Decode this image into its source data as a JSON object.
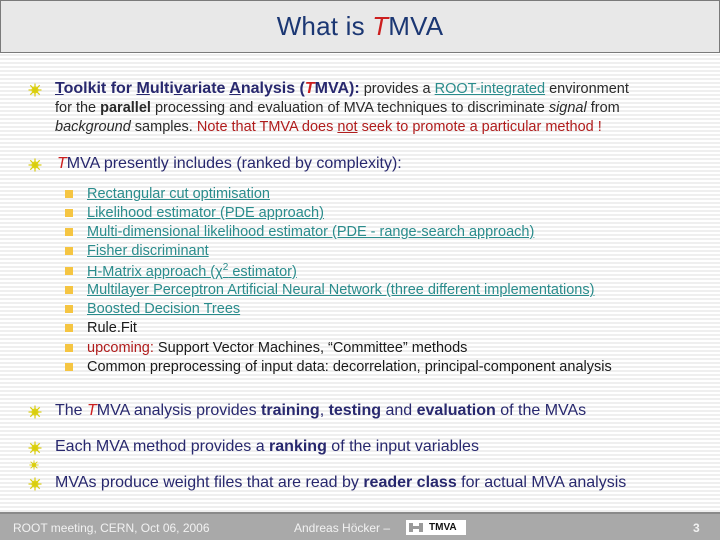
{
  "title": {
    "prefix": "What is ",
    "red_t": "T",
    "suffix": "MVA"
  },
  "point1": {
    "lead_T": "T",
    "lead_1": "oolkit for ",
    "lead_M": "M",
    "lead_2": "ulti",
    "lead_v": "v",
    "lead_3": "ariate ",
    "lead_A": "A",
    "lead_4": "nalysis (",
    "lead_red": "T",
    "lead_5": "MVA):",
    "rest_1": " provides a ",
    "link": "ROOT-integrated",
    "rest_2": " environment",
    "line2_a": "for the ",
    "line2_bold": "parallel",
    "line2_b": " processing and evaluation of MVA techniques to discriminate ",
    "line2_it": "signal",
    "line2_c": " from",
    "line3_it": "background",
    "line3_a": " samples. ",
    "line3_red_a": "Note that TMVA does ",
    "line3_red_u": "not",
    "line3_red_b": " seek to promote a particular method !"
  },
  "point2": {
    "red_t": "T",
    "text": "MVA presently includes (ranked by complexity):",
    "items": [
      {
        "label": "Rectangular cut optimisation",
        "link": true
      },
      {
        "label": "Likelihood estimator (PDE approach)",
        "link": true
      },
      {
        "label": "Multi-dimensional likelihood estimator (PDE - range-search approach)",
        "link": true
      },
      {
        "label": "Fisher discriminant",
        "link": true
      },
      {
        "label_a": "H-Matrix approach (",
        "chi": "χ",
        "sup": "2",
        "label_b": " estimator)",
        "link": true
      },
      {
        "label": "Multilayer Perceptron Artificial Neural Network (three different implementations)",
        "link": true
      },
      {
        "label": "Boosted Decision Trees",
        "link": true
      },
      {
        "label": "Rule.Fit",
        "link": false
      },
      {
        "red": "upcoming:",
        "label": " Support Vector Machines, “Committee” methods",
        "link": false
      },
      {
        "label": "Common preprocessing of input data: decorrelation, principal-component analysis",
        "link": false
      }
    ]
  },
  "point3": {
    "a": "The ",
    "red_t": "T",
    "b": "MVA analysis provides ",
    "bold1": "training",
    "c": ", ",
    "bold2": "testing",
    "d": " and ",
    "bold3": "evaluation",
    "e": " of the MVAs"
  },
  "point4": {
    "a": "Each MVA method provides a ",
    "bold": "ranking",
    "b": " of the input variables"
  },
  "point5": {
    "a": "MVAs produce weight files that are read by ",
    "bold": "reader class",
    "b": " for actual MVA analysis"
  },
  "footer": {
    "left": "ROOT meeting, CERN, Oct 06, 2006",
    "middle": "Andreas Höcker –",
    "logo_text": "TMVA",
    "page": "3"
  }
}
